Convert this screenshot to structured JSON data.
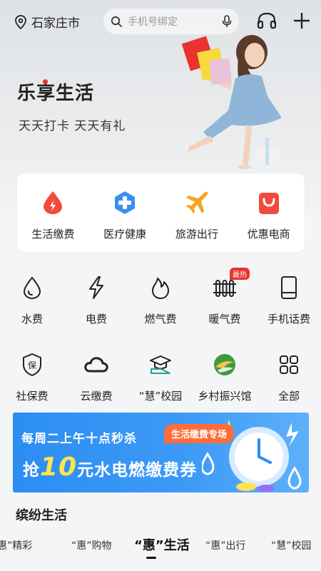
{
  "header": {
    "city": "石家庄市",
    "search_placeholder": "手机号绑定",
    "icons": [
      "location-pin-icon",
      "search-icon",
      "microphone-icon",
      "headset-icon",
      "plus-icon"
    ]
  },
  "hero": {
    "title": "乐享生活",
    "subtitle": "天天打卡  天天有礼"
  },
  "categories": [
    {
      "label": "生活缴费",
      "icon": "bill-drop-icon",
      "color": "#f24a3c"
    },
    {
      "label": "医疗健康",
      "icon": "medical-cross-icon",
      "color": "#3c8ff0"
    },
    {
      "label": "旅游出行",
      "icon": "airplane-icon",
      "color": "#f5a623"
    },
    {
      "label": "优惠电商",
      "icon": "shopping-bag-icon",
      "color": "#f24a3c"
    }
  ],
  "services": [
    {
      "label": "水费",
      "icon": "water-drop-icon"
    },
    {
      "label": "电费",
      "icon": "lightning-icon"
    },
    {
      "label": "燃气费",
      "icon": "flame-icon"
    },
    {
      "label": "暖气费",
      "icon": "radiator-icon",
      "badge": "最热"
    },
    {
      "label": "手机话费",
      "icon": "phone-icon"
    },
    {
      "label": "社保费",
      "icon": "shield-icon"
    },
    {
      "label": "云缴费",
      "icon": "cloud-icon"
    },
    {
      "label": "“慧”校园",
      "icon": "graduation-icon"
    },
    {
      "label": "乡村振兴馆",
      "icon": "village-logo-icon"
    },
    {
      "label": "全部",
      "icon": "grid-all-icon"
    }
  ],
  "banner": {
    "line1": "每周二上午十点秒杀",
    "line2_prefix": "抢",
    "line2_number": "10",
    "line2_suffix": "元水电燃缴费券",
    "tag": "生活缴费专场"
  },
  "section": {
    "title": "缤纷生活",
    "tabs": [
      "惠”精彩",
      "“惠”购物",
      "“惠”生活",
      "“惠”出行",
      "“慧”校园"
    ],
    "active_tab": 2
  },
  "colors": {
    "accent_red": "#e8332e",
    "banner_blue": "#2c8df2",
    "banner_yellow": "#ffe34d"
  }
}
